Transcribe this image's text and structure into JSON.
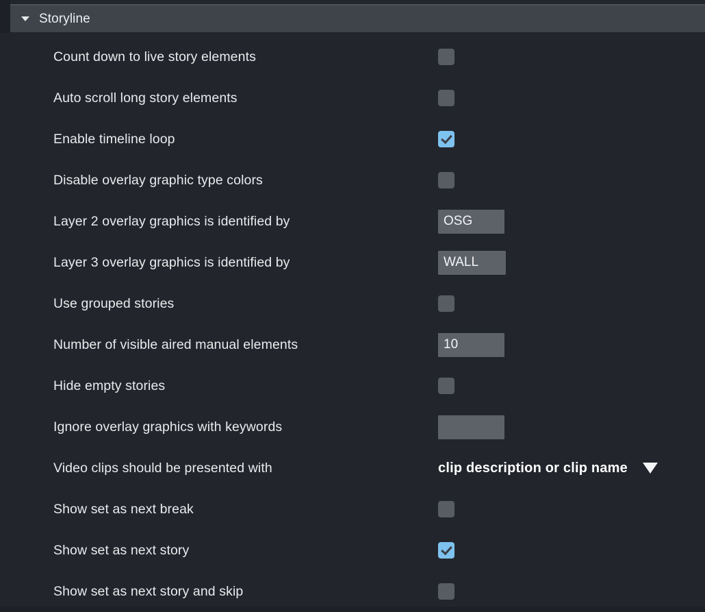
{
  "section": {
    "title": "Storyline",
    "collapse_icon": "triangle-down-icon",
    "expanded": true
  },
  "colors": {
    "background": "#22262c",
    "header_bar": "#3f444a",
    "checkbox_off": "#585d64",
    "checkbox_on": "#7ec2ef",
    "field_bg": "#5d6168",
    "text": "#e9ebed"
  },
  "settings": [
    {
      "label": "Count down to live story elements",
      "type": "checkbox",
      "checked": false
    },
    {
      "label": "Auto scroll long story elements",
      "type": "checkbox",
      "checked": false
    },
    {
      "label": "Enable timeline loop",
      "type": "checkbox",
      "checked": true
    },
    {
      "label": "Disable overlay graphic type colors",
      "type": "checkbox",
      "checked": false
    },
    {
      "label": "Layer 2 overlay graphics is identified by",
      "type": "text",
      "value": "OSG",
      "placeholder": ""
    },
    {
      "label": "Layer 3 overlay graphics is identified by",
      "type": "text",
      "value": "WALL",
      "placeholder": ""
    },
    {
      "label": "Use grouped stories",
      "type": "checkbox",
      "checked": false
    },
    {
      "label": "Number of visible aired manual elements",
      "type": "text",
      "value": "10",
      "placeholder": ""
    },
    {
      "label": "Hide empty stories",
      "type": "checkbox",
      "checked": false
    },
    {
      "label": "Ignore overlay graphics with keywords",
      "type": "text",
      "value": "",
      "placeholder": ""
    },
    {
      "label": "Video clips should be presented with",
      "type": "dropdown",
      "value": "clip description or clip name",
      "arrow_icon": "triangle-down-icon"
    },
    {
      "label": "Show set as next break",
      "type": "checkbox",
      "checked": false
    },
    {
      "label": "Show set as next story",
      "type": "checkbox",
      "checked": true
    },
    {
      "label": "Show set as next story and skip",
      "type": "checkbox",
      "checked": false
    }
  ]
}
